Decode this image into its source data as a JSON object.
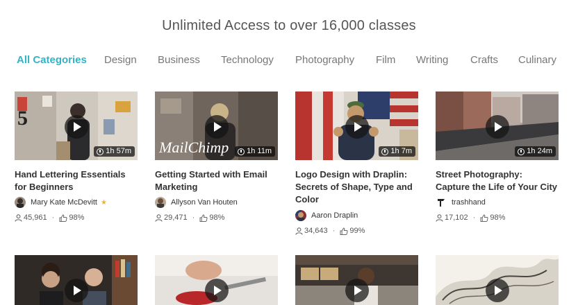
{
  "header": {
    "title": "Unlimited Access to over 16,000 classes"
  },
  "tabs": [
    {
      "label": "All Categories",
      "active": true
    },
    {
      "label": "Design"
    },
    {
      "label": "Business"
    },
    {
      "label": "Technology"
    },
    {
      "label": "Photography"
    },
    {
      "label": "Film"
    },
    {
      "label": "Writing"
    },
    {
      "label": "Crafts"
    },
    {
      "label": "Culinary"
    }
  ],
  "colors": {
    "accent": "#35b2c4",
    "star": "#e8b33a"
  },
  "classes": [
    {
      "title": "Hand Lettering Essentials for Beginners",
      "duration": "1h 57m",
      "teacher": "Mary Kate McDevitt",
      "staff_pick_icon": "star-icon",
      "students": "45,961",
      "rating": "98%"
    },
    {
      "title": "Getting Started with Email Marketing",
      "duration": "1h 11m",
      "thumb_text": "MailChimp",
      "teacher": "Allyson Van Houten",
      "students": "29,471",
      "rating": "98%"
    },
    {
      "title": "Logo Design with Draplin: Secrets of Shape, Type and Color",
      "duration": "1h 7m",
      "teacher": "Aaron Draplin",
      "students": "34,643",
      "rating": "99%"
    },
    {
      "title": "Street Photography: Capture the Life of Your City",
      "duration": "1h 24m",
      "teacher": "trashhand",
      "students": "17,102",
      "rating": "98%"
    }
  ]
}
